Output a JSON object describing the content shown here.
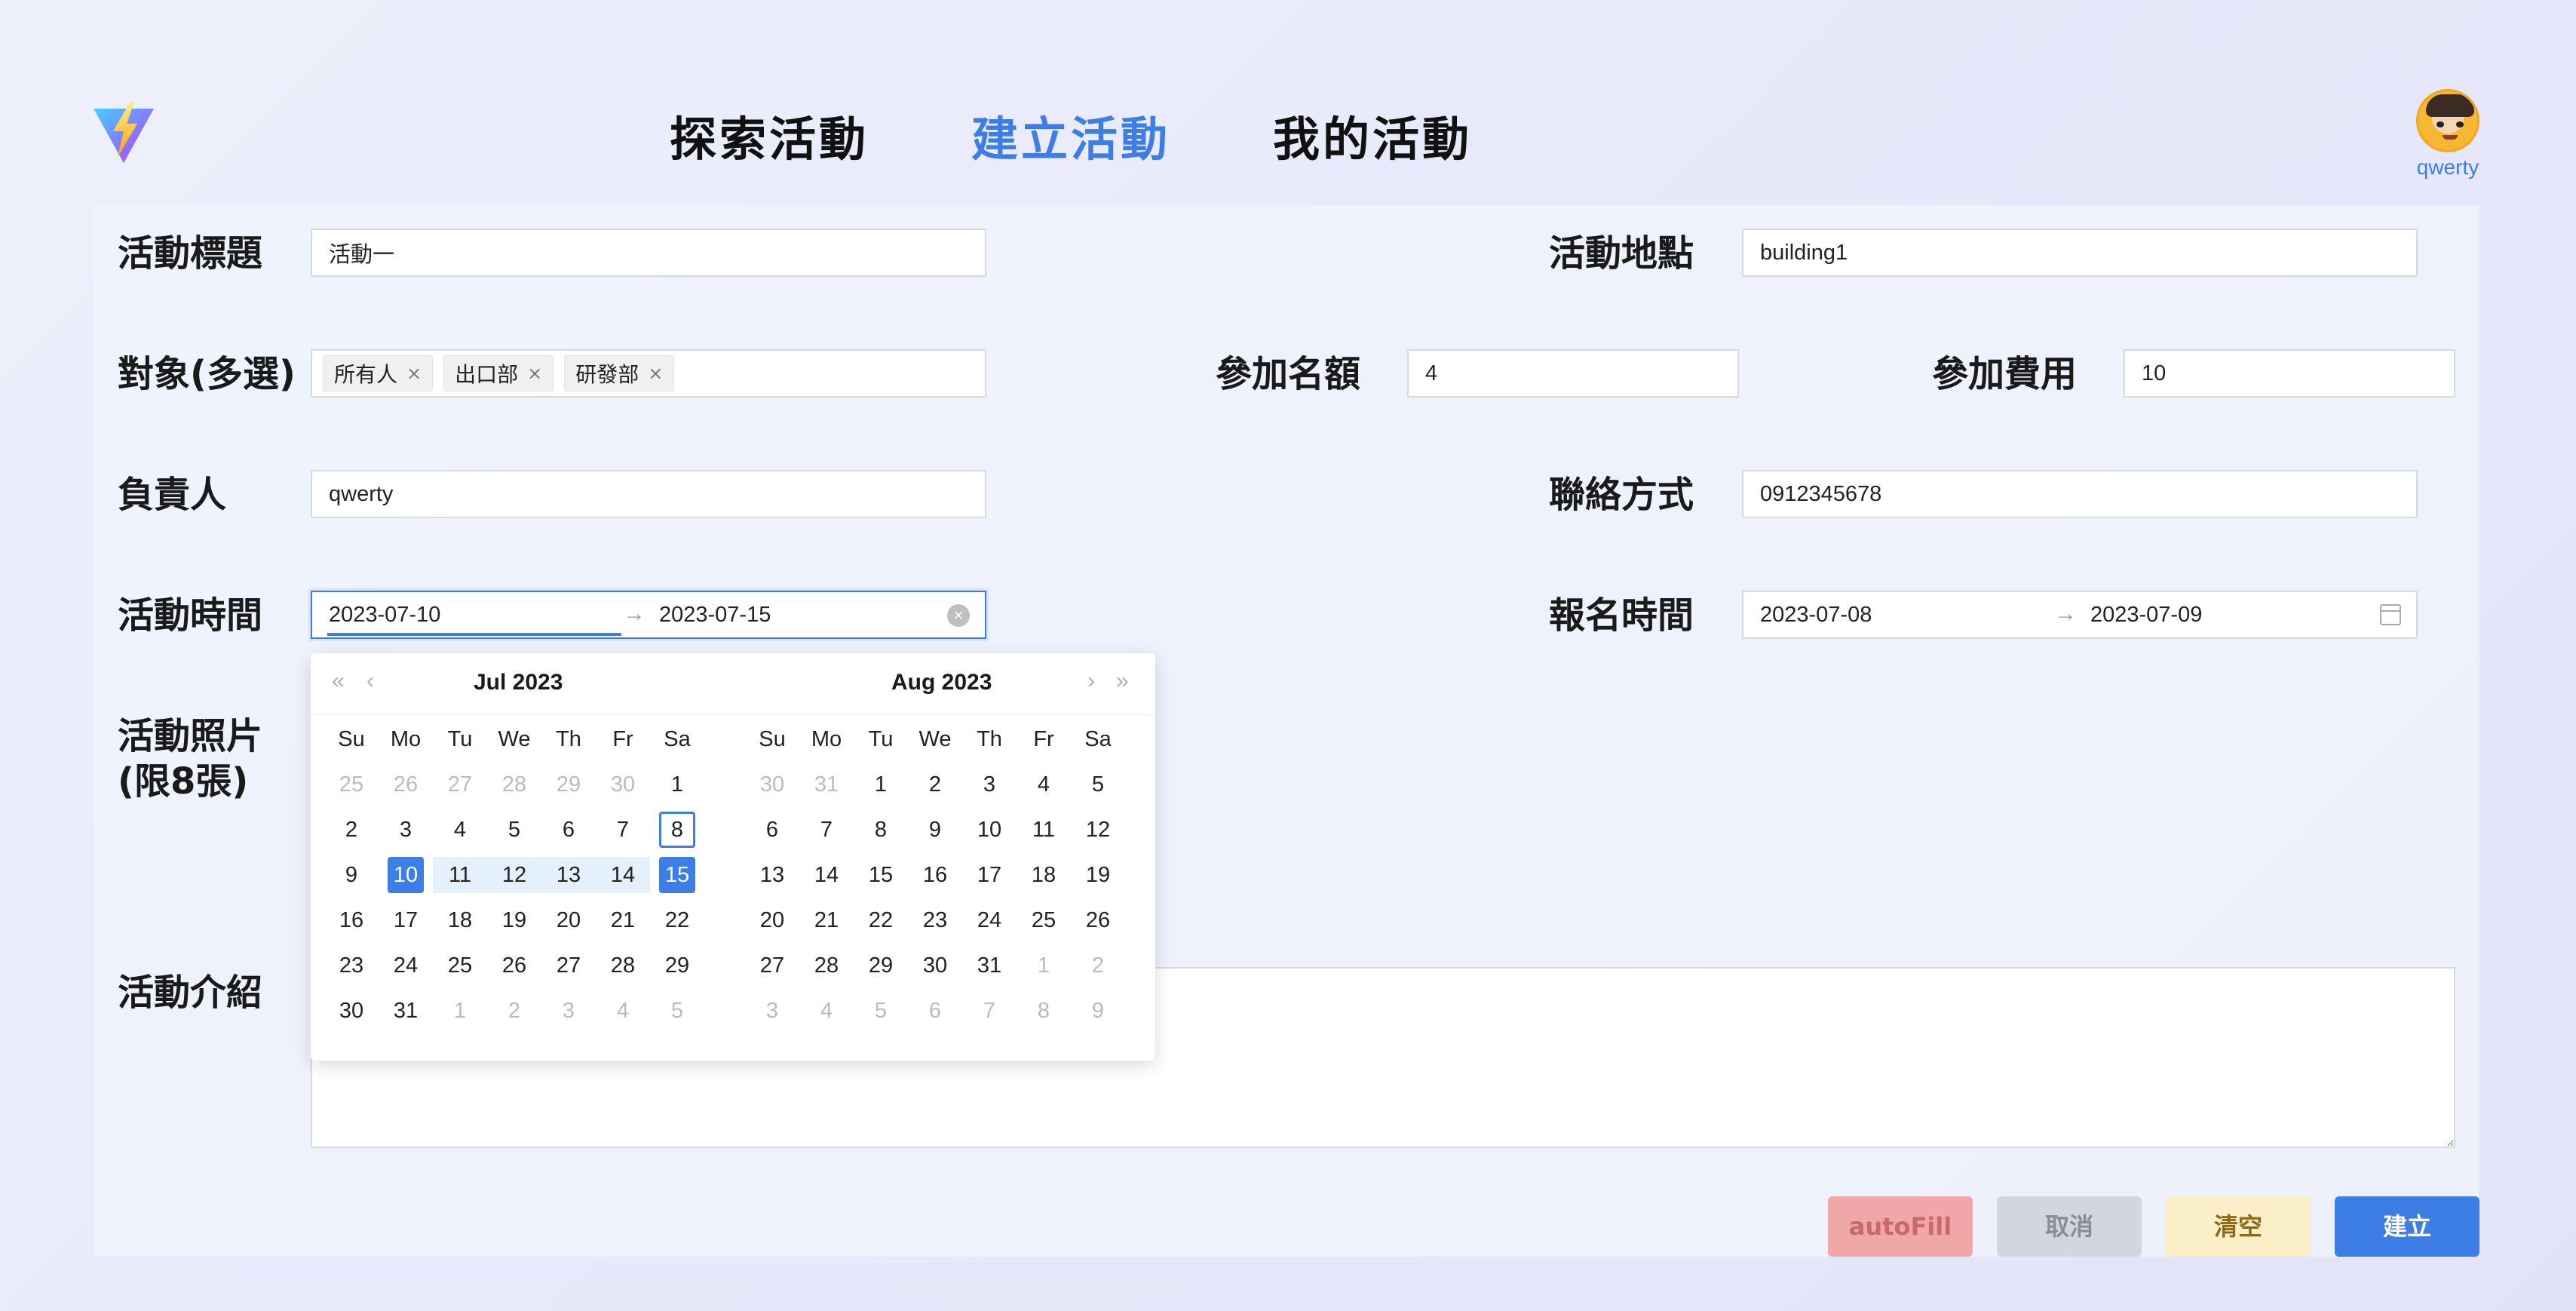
{
  "nav": {
    "explore": "探索活動",
    "create": "建立活動",
    "mine": "我的活動"
  },
  "user": {
    "name": "qwerty"
  },
  "form": {
    "title_label": "活動標題",
    "title_value": "活動一",
    "location_label": "活動地點",
    "location_value": "building1",
    "target_label": "對象(多選)",
    "target_tags": [
      "所有人",
      "出口部",
      "研發部"
    ],
    "quota_label": "參加名額",
    "quota_value": "4",
    "fee_label": "參加費用",
    "fee_value": "10",
    "owner_label": "負責人",
    "owner_value": "qwerty",
    "contact_label": "聯絡方式",
    "contact_value": "0912345678",
    "time_label": "活動時間",
    "time_start": "2023-07-10",
    "time_end": "2023-07-15",
    "signup_label": "報名時間",
    "signup_start": "2023-07-08",
    "signup_end": "2023-07-09",
    "photo_label_line1": "活動照片",
    "photo_label_line2": "(限8張)",
    "intro_label": "活動介紹"
  },
  "calendar": {
    "left_title": "Jul  2023",
    "right_title": "Aug  2023",
    "weekdays": [
      "Su",
      "Mo",
      "Tu",
      "We",
      "Th",
      "Fr",
      "Sa"
    ],
    "left_days": [
      [
        "25",
        "26",
        "27",
        "28",
        "29",
        "30",
        "1"
      ],
      [
        "2",
        "3",
        "4",
        "5",
        "6",
        "7",
        "8"
      ],
      [
        "9",
        "10",
        "11",
        "12",
        "13",
        "14",
        "15"
      ],
      [
        "16",
        "17",
        "18",
        "19",
        "20",
        "21",
        "22"
      ],
      [
        "23",
        "24",
        "25",
        "26",
        "27",
        "28",
        "29"
      ],
      [
        "30",
        "31",
        "1",
        "2",
        "3",
        "4",
        "5"
      ]
    ],
    "right_days": [
      [
        "30",
        "31",
        "1",
        "2",
        "3",
        "4",
        "5"
      ],
      [
        "6",
        "7",
        "8",
        "9",
        "10",
        "11",
        "12"
      ],
      [
        "13",
        "14",
        "15",
        "16",
        "17",
        "18",
        "19"
      ],
      [
        "20",
        "21",
        "22",
        "23",
        "24",
        "25",
        "26"
      ],
      [
        "27",
        "28",
        "29",
        "30",
        "31",
        "1",
        "2"
      ],
      [
        "3",
        "4",
        "5",
        "6",
        "7",
        "8",
        "9"
      ]
    ]
  },
  "buttons": {
    "autofill": "autoFill",
    "cancel": "取消",
    "clear": "清空",
    "create": "建立"
  },
  "colors": {
    "accent": "#3d7de6",
    "autofill_bg": "#f0a7a7",
    "cancel_bg": "#d4d6dd",
    "clear_bg": "#fbefc8"
  }
}
